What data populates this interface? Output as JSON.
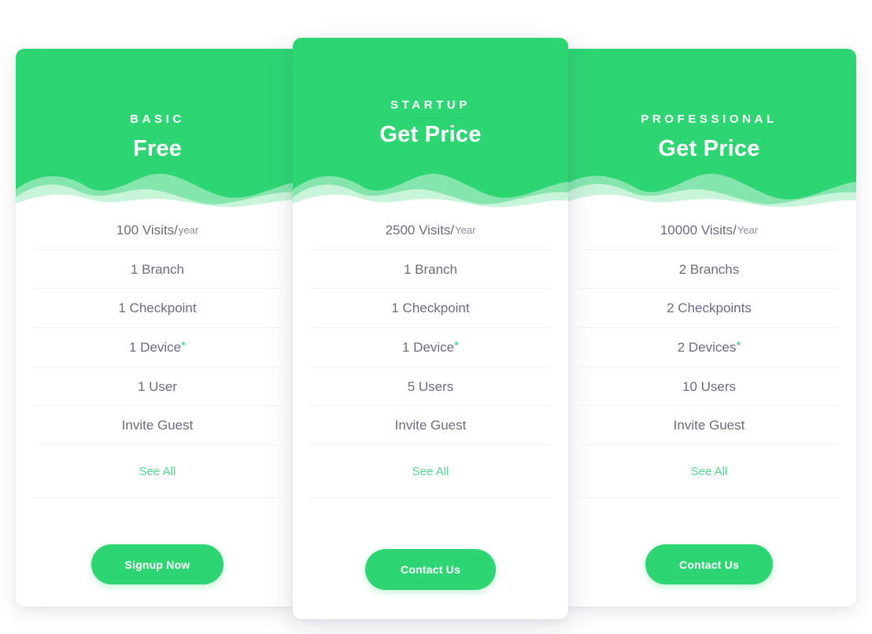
{
  "theme": {
    "accent_green": "#2ed573",
    "link_green": "#4fd98a",
    "feature_text": "#6d6b80",
    "divider": "#f0f1f5",
    "page_background": "#ffffff",
    "wave_overlay": "rgba(255,255,255,0.45)"
  },
  "plans": [
    {
      "id": "basic",
      "name": "BASIC",
      "price": "Free",
      "featured": false,
      "features": [
        {
          "text": "100 Visits/",
          "unit": "year",
          "star": ""
        },
        {
          "text": "1 Branch",
          "unit": "",
          "star": ""
        },
        {
          "text": "1 Checkpoint",
          "unit": "",
          "star": ""
        },
        {
          "text": "1 Device",
          "unit": "",
          "star": "*"
        },
        {
          "text": "1 User",
          "unit": "",
          "star": ""
        },
        {
          "text": "Invite Guest",
          "unit": "",
          "star": ""
        }
      ],
      "see_all_label": "See All",
      "cta_label": "Signup Now"
    },
    {
      "id": "startup",
      "name": "STARTUP",
      "price": "Get Price",
      "featured": true,
      "features": [
        {
          "text": "2500 Visits/",
          "unit": "Year",
          "star": ""
        },
        {
          "text": "1 Branch",
          "unit": "",
          "star": ""
        },
        {
          "text": "1 Checkpoint",
          "unit": "",
          "star": ""
        },
        {
          "text": "1 Device",
          "unit": "",
          "star": "*"
        },
        {
          "text": "5 Users",
          "unit": "",
          "star": ""
        },
        {
          "text": "Invite Guest",
          "unit": "",
          "star": ""
        }
      ],
      "see_all_label": "See All",
      "cta_label": "Contact Us"
    },
    {
      "id": "professional",
      "name": "PROFESSIONAL",
      "price": "Get Price",
      "featured": false,
      "features": [
        {
          "text": "10000 Visits/",
          "unit": "Year",
          "star": ""
        },
        {
          "text": "2 Branchs",
          "unit": "",
          "star": ""
        },
        {
          "text": "2 Checkpoints",
          "unit": "",
          "star": ""
        },
        {
          "text": "2 Devices",
          "unit": "",
          "star": "*"
        },
        {
          "text": "10 Users",
          "unit": "",
          "star": ""
        },
        {
          "text": "Invite Guest",
          "unit": "",
          "star": ""
        }
      ],
      "see_all_label": "See All",
      "cta_label": "Contact Us"
    }
  ]
}
